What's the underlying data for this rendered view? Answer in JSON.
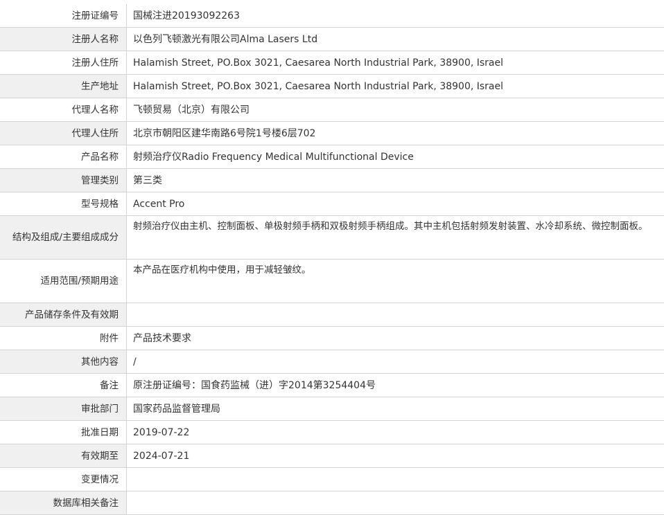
{
  "rows": [
    {
      "label": "注册证编号",
      "value": "国械注进20193092263"
    },
    {
      "label": "注册人名称",
      "value": "以色列飞顿激光有限公司Alma Lasers Ltd"
    },
    {
      "label": "注册人住所",
      "value": "Halamish Street, PO.Box 3021, Caesarea North Industrial Park, 38900, Israel"
    },
    {
      "label": "生产地址",
      "value": "Halamish Street, PO.Box 3021, Caesarea North Industrial Park, 38900, Israel"
    },
    {
      "label": "代理人名称",
      "value": "飞顿贸易（北京）有限公司"
    },
    {
      "label": "代理人住所",
      "value": "北京市朝阳区建华南路6号院1号楼6层702"
    },
    {
      "label": "产品名称",
      "value": "射频治疗仪Radio Frequency Medical Multifunctional Device"
    },
    {
      "label": "管理类别",
      "value": "第三类"
    },
    {
      "label": "型号规格",
      "value": "Accent Pro"
    },
    {
      "label": "结构及组成/主要组成成分",
      "value": "射频治疗仪由主机、控制面板、单极射频手柄和双极射频手柄组成。其中主机包括射频发射装置、水冷却系统、微控制面板。"
    },
    {
      "label": "适用范围/预期用途",
      "value": "本产品在医疗机构中使用，用于减轻皱纹。"
    },
    {
      "label": "产品储存条件及有效期",
      "value": ""
    },
    {
      "label": "附件",
      "value": "产品技术要求"
    },
    {
      "label": "其他内容",
      "value": "/"
    },
    {
      "label": "备注",
      "value": "原注册证编号：国食药监械（进）字2014第3254404号"
    },
    {
      "label": "审批部门",
      "value": "国家药品监督管理局"
    },
    {
      "label": "批准日期",
      "value": "2019-07-22"
    },
    {
      "label": "有效期至",
      "value": "2024-07-21"
    },
    {
      "label": "变更情况",
      "value": ""
    },
    {
      "label": "数据库相关备注",
      "value": ""
    }
  ]
}
